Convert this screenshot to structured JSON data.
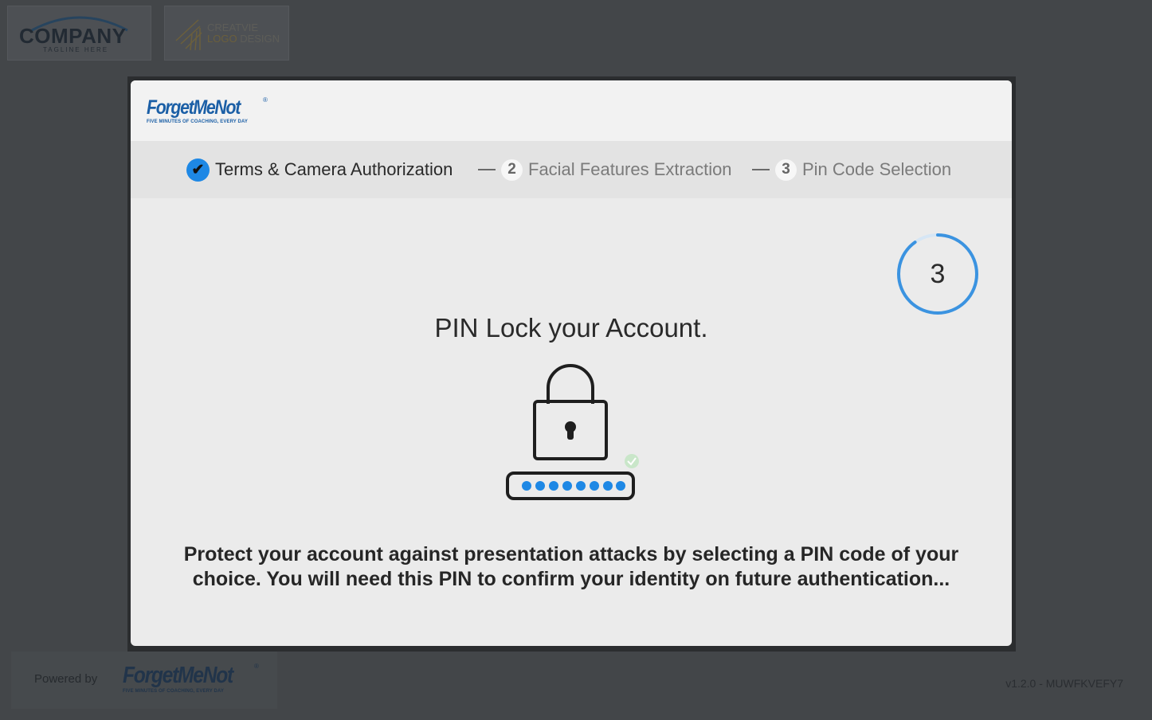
{
  "brand_logos": {
    "company_name": "COMPANY",
    "company_tagline": "TAGLINE HERE",
    "creative_line1": "CREATVIE",
    "creative_line2_a": "LOGO",
    "creative_line2_b": " DESIGN"
  },
  "modal": {
    "logo_title": "ForgetMeNot",
    "logo_reg": "®",
    "logo_tagline": "FIVE MINUTES OF COACHING, EVERY DAY",
    "steps": [
      {
        "number": "✔",
        "label": "Terms & Camera Authorization",
        "state": "done"
      },
      {
        "number": "2",
        "label": "Facial Features Extraction",
        "state": "todo"
      },
      {
        "number": "3",
        "label": "Pin Code Selection",
        "state": "todo"
      }
    ],
    "countdown": "3",
    "countdown_fraction": 0.9,
    "title": "PIN Lock your Account.",
    "description": "Protect your account against presentation attacks by selecting a PIN code of your choice. You will need this PIN to confirm your identity on future authentication..."
  },
  "footer": {
    "powered_by": "Powered by",
    "logo_title": "ForgetMeNot",
    "logo_reg": "®",
    "logo_tagline": "FIVE MINUTES OF COACHING, EVERY DAY",
    "version": "v1.2.0 - MUWFKVEFY7"
  },
  "colors": {
    "accent": "#1e88e5",
    "brand": "#1b5fa6",
    "background": "#434649"
  }
}
